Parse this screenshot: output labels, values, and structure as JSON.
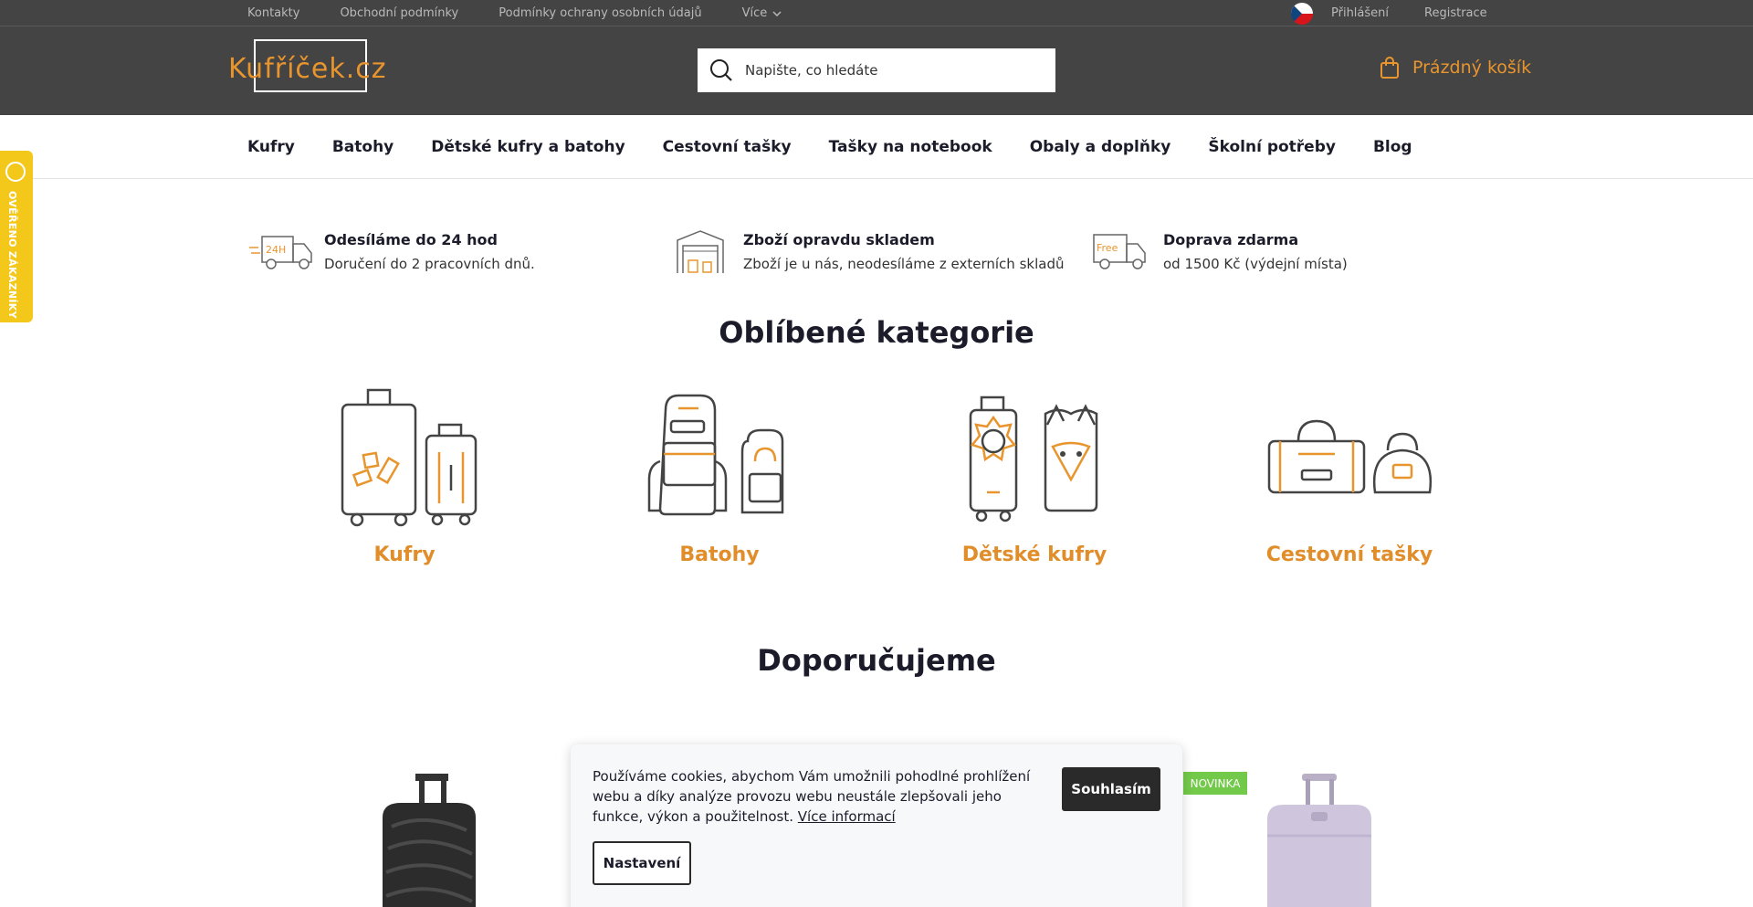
{
  "topbar": {
    "links": [
      "Kontakty",
      "Obchodní podmínky",
      "Podmínky ochrany osobních údajů"
    ],
    "more_label": "Více",
    "login": "Přihlášení",
    "register": "Registrace"
  },
  "header": {
    "logo_text": "Kufříček.cz",
    "search_placeholder": "Napište, co hledáte",
    "cart_label": "Prázdný košík"
  },
  "nav": {
    "items": [
      "Kufry",
      "Batohy",
      "Dětské kufry a batohy",
      "Cestovní tašky",
      "Tašky na notebook",
      "Obaly a doplňky",
      "Školní potřeby",
      "Blog"
    ]
  },
  "badge": {
    "text": "OVĚŘENO ZÁKAZNÍKY"
  },
  "usps": [
    {
      "title": "Odesíláme do 24 hod",
      "subtitle": "Doručení do 2 pracovních dnů.",
      "icon_text": "24H"
    },
    {
      "title": "Zboží opravdu skladem",
      "subtitle": "Zboží je u nás, neodesíláme z externích skladů"
    },
    {
      "title": "Doprava zdarma",
      "subtitle": "od 1500 Kč (výdejní místa)",
      "icon_text": "Free"
    }
  ],
  "sections": {
    "categories_title": "Oblíbené kategorie",
    "recommend_title": "Doporučujeme"
  },
  "categories": [
    "Kufry",
    "Batohy",
    "Dětské kufry",
    "Cestovní tašky"
  ],
  "products": {
    "badge_new": "NOVINKA"
  },
  "cookie": {
    "text": "Používáme cookies, abychom Vám umožnili pohodlné prohlížení webu a díky analýze provozu webu neustále zlepšovali jeho funkce, výkon a použitelnost.",
    "more_link": "Více informací",
    "agree": "Souhlasím",
    "settings": "Nastavení"
  },
  "colors": {
    "header_bg": "#444444",
    "accent": "#e8952d",
    "badge_yellow": "#f3c81b",
    "new_green": "#73c94a"
  }
}
